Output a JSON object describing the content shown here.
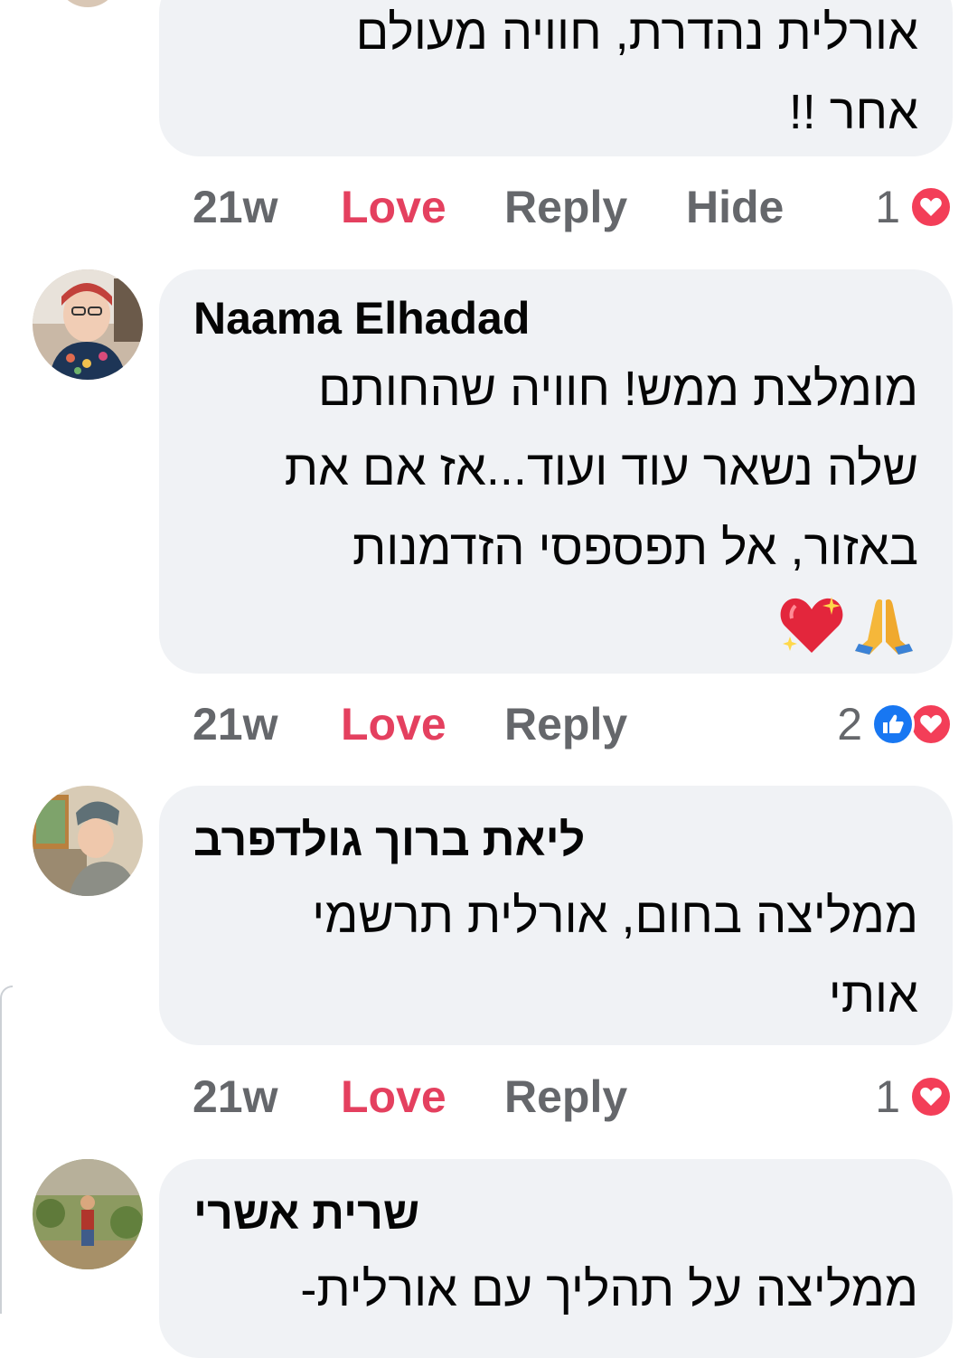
{
  "comments": [
    {
      "text_lines": [
        "אורלית נהדרת, חוויה מעולם",
        "אחר !!"
      ],
      "time": "21w",
      "love_label": "Love",
      "reply_label": "Reply",
      "hide_label": "Hide",
      "reaction_count": "1",
      "reactions": [
        "heart-icon"
      ]
    },
    {
      "author": "Naama Elhadad",
      "text_lines": [
        "מומלצת ממש! חוויה שהחותם",
        "שלה נשאר עוד ועוד...אז אם את",
        "באזור, אל תפספסי הזדמנות"
      ],
      "emojis": [
        "praying-hands-emoji",
        "sparkling-heart-emoji"
      ],
      "time": "21w",
      "love_label": "Love",
      "reply_label": "Reply",
      "reaction_count": "2",
      "reactions": [
        "like-icon",
        "heart-icon"
      ]
    },
    {
      "author": "ליאת ברוך גולדפרב",
      "text_lines": [
        "ממליצה בחום, אורלית תרשמי",
        "אותי"
      ],
      "time": "21w",
      "love_label": "Love",
      "reply_label": "Reply",
      "reaction_count": "1",
      "reactions": [
        "heart-icon"
      ]
    },
    {
      "author": "שרית אשרי",
      "text_lines": [
        "ממליצה על תהליך עם אורלית-"
      ]
    }
  ],
  "colors": {
    "bubble": "#f0f2f5",
    "meta_text": "#65676b",
    "love_active": "#e4405f",
    "heart_reaction": "#f33e58",
    "like_reaction": "#1877f2"
  }
}
